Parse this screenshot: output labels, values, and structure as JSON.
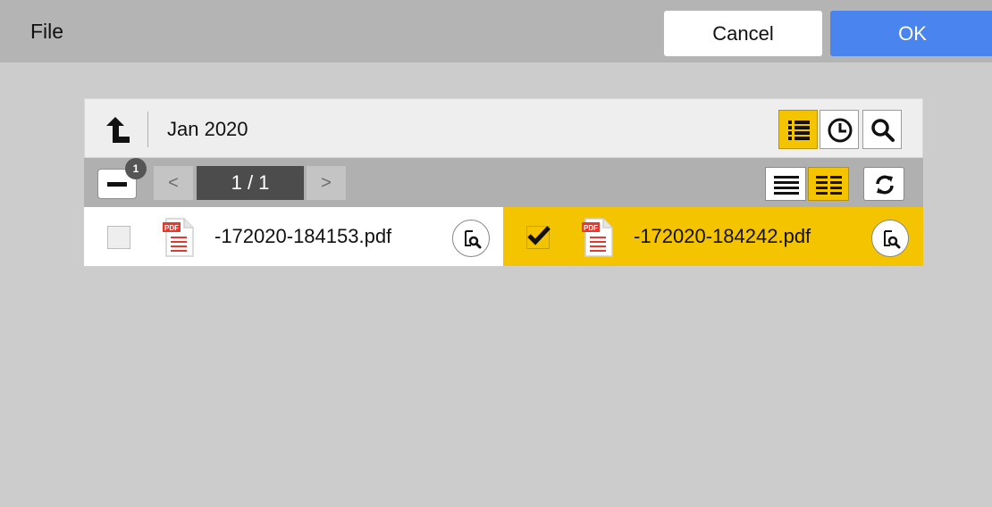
{
  "header": {
    "title": "File",
    "cancel_label": "Cancel",
    "ok_label": "OK"
  },
  "browser": {
    "folder_name": "Jan 2020",
    "selection_count": "1",
    "pagination": {
      "prev_label": "<",
      "page_label": "1 / 1",
      "next_label": ">"
    },
    "view_modes": [
      {
        "icon": "list-view-icon",
        "active": true
      },
      {
        "icon": "recent-clock-icon",
        "active": false
      },
      {
        "icon": "search-icon",
        "active": false
      }
    ],
    "layout_modes": [
      {
        "icon": "single-column-icon",
        "active": false
      },
      {
        "icon": "two-column-icon",
        "active": true
      }
    ],
    "files": [
      {
        "name": "-172020-184153.pdf",
        "selected": false,
        "icon": "pdf-file-icon"
      },
      {
        "name": "-172020-184242.pdf",
        "selected": true,
        "icon": "pdf-file-icon"
      }
    ]
  },
  "colors": {
    "accent_yellow": "#f5c400",
    "ok_blue": "#4a84ee",
    "background": "#cccccc",
    "titlebar": "#b4b4b4"
  }
}
